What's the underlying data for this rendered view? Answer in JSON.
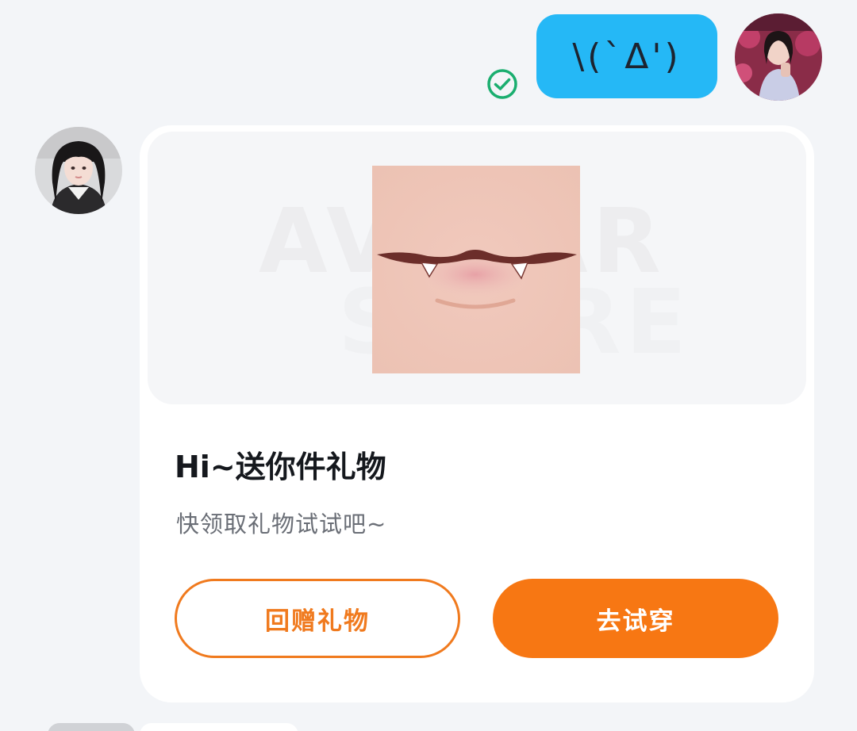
{
  "outgoing_message": {
    "text": "\\(`Δ')",
    "status_icon": "check-circle-icon",
    "status_color": "#1aae6f",
    "bubble_color": "#25b8f6"
  },
  "gift_card": {
    "watermark_line1": "AVATAR",
    "watermark_line2": "STORE",
    "title": "Hi~送你件礼物",
    "subtitle": "快领取礼物试试吧~",
    "return_gift_label": "回赠礼物",
    "try_on_label": "去试穿",
    "accent_color": "#f77713"
  }
}
